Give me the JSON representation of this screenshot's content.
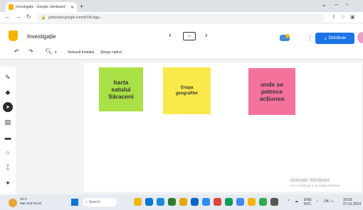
{
  "browser": {
    "tab_title": "Investigație - Google Jamboard",
    "url": "jamboard.google.com/d/1WJqgs..."
  },
  "app": {
    "title": "Investigație",
    "frame_indicator": "1/1",
    "share_label": "Distribuie"
  },
  "toolbar": {
    "set_background": "Setează fundalul",
    "clear_frame": "Șterge cadrul"
  },
  "notes": [
    {
      "text": "harta\nsatului\nSăraceni",
      "color": "#a9e045"
    },
    {
      "text": "Grupa\ngeografilor",
      "color": "#fbe84b"
    },
    {
      "text": "unde se\npetrece\nacțiunea",
      "color": "#f4739b"
    }
  ],
  "watermark": {
    "title": "Activate Windows",
    "subtitle": "Go to Settings to activate Windows."
  },
  "taskbar": {
    "temperature": "19°C",
    "condition": "Mai mult însorit",
    "search_label": "Search",
    "language": "ENG",
    "keyboard": "INTL",
    "battery": "OK",
    "time": "16:03",
    "date": "27.01.2024"
  },
  "colors": {
    "share_button": "#1a73e8",
    "selected_tool": "#2b2b2b",
    "canvas_bg": "#f1f3f4"
  }
}
